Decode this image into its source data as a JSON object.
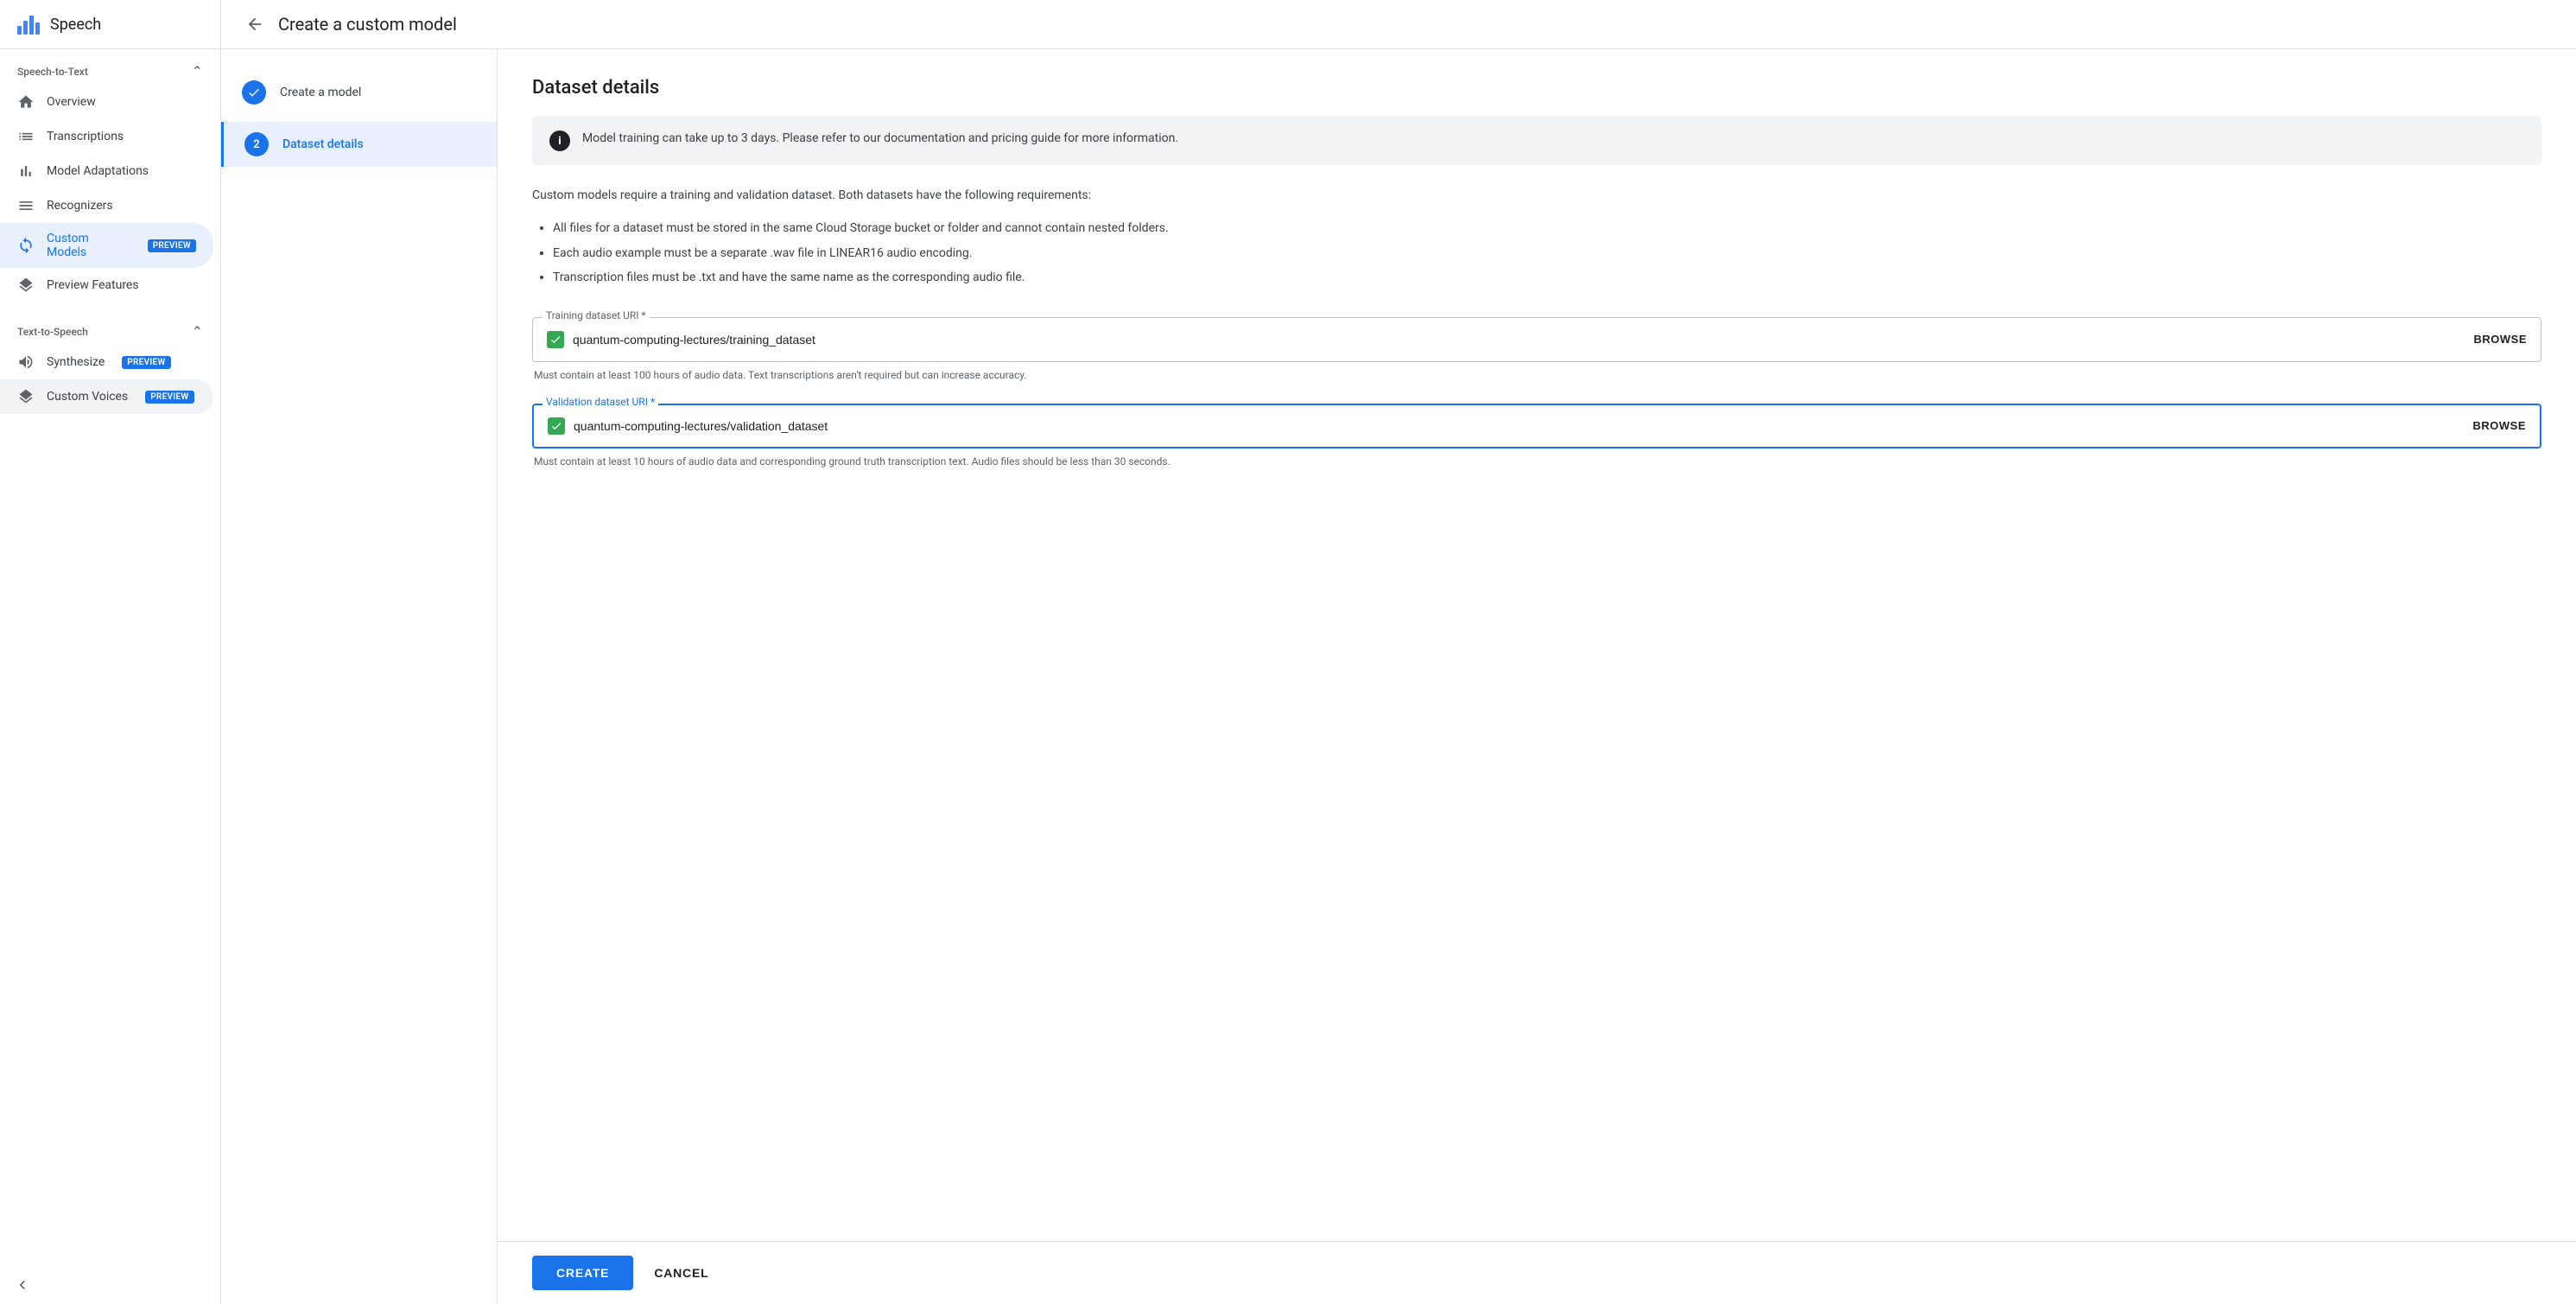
{
  "app": {
    "title": "Speech"
  },
  "sidebar": {
    "section_speech": "Speech-to-Text",
    "section_tts": "Text-to-Speech",
    "items_speech": [
      {
        "id": "overview",
        "label": "Overview",
        "icon": "home"
      },
      {
        "id": "transcriptions",
        "label": "Transcriptions",
        "icon": "list"
      },
      {
        "id": "model-adaptations",
        "label": "Model Adaptations",
        "icon": "chart"
      },
      {
        "id": "recognizers",
        "label": "Recognizers",
        "icon": "list"
      },
      {
        "id": "custom-models",
        "label": "Custom Models",
        "icon": "refresh",
        "badge": "PREVIEW",
        "active": true
      },
      {
        "id": "preview-features",
        "label": "Preview Features",
        "icon": "layers"
      }
    ],
    "items_tts": [
      {
        "id": "synthesize",
        "label": "Synthesize",
        "icon": "wave",
        "badge": "PREVIEW"
      },
      {
        "id": "custom-voices",
        "label": "Custom Voices",
        "icon": "layers",
        "badge": "PREVIEW",
        "active_bg": true
      }
    ]
  },
  "page": {
    "back_label": "←",
    "title": "Create a custom model"
  },
  "steps": [
    {
      "id": "create-model",
      "label": "Create a model",
      "status": "completed",
      "number": "✓"
    },
    {
      "id": "dataset-details",
      "label": "Dataset details",
      "status": "current",
      "number": "2"
    }
  ],
  "dataset": {
    "title": "Dataset details",
    "info_text": "Model training can take up to 3 days. Please refer to our documentation and pricing guide for more information.",
    "description": "Custom models require a training and validation dataset. Both datasets have the following requirements:",
    "requirements": [
      "All files for a dataset must be stored in the same Cloud Storage bucket or folder and cannot contain nested folders.",
      "Each audio example must be a separate .wav file in LINEAR16 audio encoding.",
      "Transcription files must be .txt and have the same name as the corresponding audio file."
    ],
    "training_field": {
      "label": "Training dataset URI *",
      "value": "quantum-computing-lectures/training_dataset",
      "browse": "BROWSE",
      "hint": "Must contain at least 100 hours of audio data. Text transcriptions aren't required but can increase accuracy."
    },
    "validation_field": {
      "label": "Validation dataset URI *",
      "value": "quantum-computing-lectures/validation_dataset",
      "browse": "BROWSE",
      "hint": "Must contain at least 10 hours of audio data and corresponding ground truth transcription text. Audio files should be less than 30 seconds."
    }
  },
  "actions": {
    "create": "CREATE",
    "cancel": "CANCEL"
  }
}
